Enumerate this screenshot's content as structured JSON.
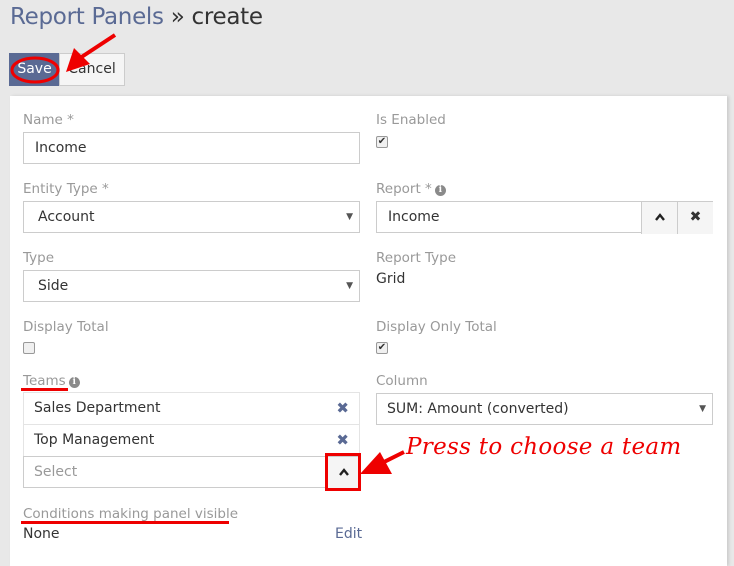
{
  "header": {
    "parent_link": "Report Panels",
    "separator": "»",
    "current": "create"
  },
  "buttons": {
    "save": "Save",
    "cancel": "Cancel"
  },
  "form": {
    "name": {
      "label": "Name *",
      "value": "Income"
    },
    "is_enabled": {
      "label": "Is Enabled",
      "checked": true,
      "mark": "✔"
    },
    "entity_type": {
      "label": "Entity Type *",
      "value": "Account"
    },
    "report": {
      "label": "Report *",
      "value": "Income",
      "select_icon": "chevron-up",
      "clear_icon": "✖"
    },
    "type": {
      "label": "Type",
      "value": "Side"
    },
    "report_type": {
      "label": "Report Type",
      "value": "Grid"
    },
    "display_total": {
      "label": "Display Total",
      "checked": false
    },
    "display_only_total": {
      "label": "Display Only Total",
      "checked": true,
      "mark": "✔"
    },
    "teams": {
      "label": "Teams",
      "items": [
        {
          "name": "Sales Department",
          "remove": "✖"
        },
        {
          "name": "Top Management",
          "remove": "✖"
        }
      ],
      "select_placeholder": "Select"
    },
    "column": {
      "label": "Column",
      "value": "SUM: Amount (converted)"
    },
    "conditions": {
      "label": "Conditions making panel visible",
      "value": "None",
      "edit_link": "Edit"
    }
  },
  "annotation": {
    "text": "Press to choose a team",
    "color": "#ee0000"
  },
  "colors": {
    "primary": "#5a6a94",
    "background": "#e8e8e8",
    "panel": "#ffffff",
    "label": "#999999"
  }
}
